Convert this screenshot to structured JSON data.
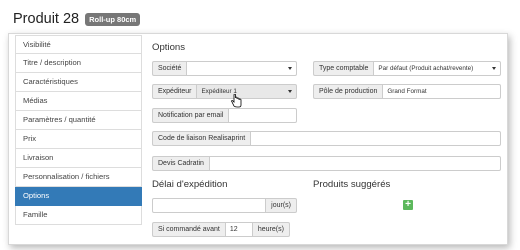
{
  "header": {
    "title": "Produit 28",
    "badge": "Roll-up 80cm"
  },
  "sidebar": {
    "items": [
      {
        "label": "Visibilité"
      },
      {
        "label": "Titre / description"
      },
      {
        "label": "Caractéristiques"
      },
      {
        "label": "Médias"
      },
      {
        "label": "Paramètres / quantité"
      },
      {
        "label": "Prix"
      },
      {
        "label": "Livraison"
      },
      {
        "label": "Personnalisation / fichiers"
      },
      {
        "label": "Options",
        "active": true
      },
      {
        "label": "Famille"
      }
    ]
  },
  "options": {
    "title": "Options",
    "societe": {
      "label": "Société",
      "value": ""
    },
    "type_comptable": {
      "label": "Type comptable",
      "value": "Par défaut (Produit achat/revente)"
    },
    "expediteur": {
      "label": "Expéditeur",
      "value": "Expéditeur 1"
    },
    "pole_production": {
      "label": "Pôle de production",
      "value": "Grand Format"
    },
    "notification_email": {
      "label": "Notification par email",
      "value": ""
    },
    "code_liaison": {
      "label": "Code de liaison Realisaprint",
      "value": ""
    },
    "devis_cadratin": {
      "label": "Devis Cadratin",
      "value": ""
    }
  },
  "delai": {
    "title": "Délai d'expédition",
    "jours_value": "",
    "jours_suffix": "jour(s)",
    "si_commande_label": "Si commandé avant",
    "heure_value": "12",
    "heure_suffix": "heure(s)"
  },
  "produits": {
    "title": "Produits suggérés",
    "add_label": "+"
  },
  "colors": {
    "active": "#337ab7",
    "add_button": "#5cb85c",
    "badge": "#777777"
  }
}
